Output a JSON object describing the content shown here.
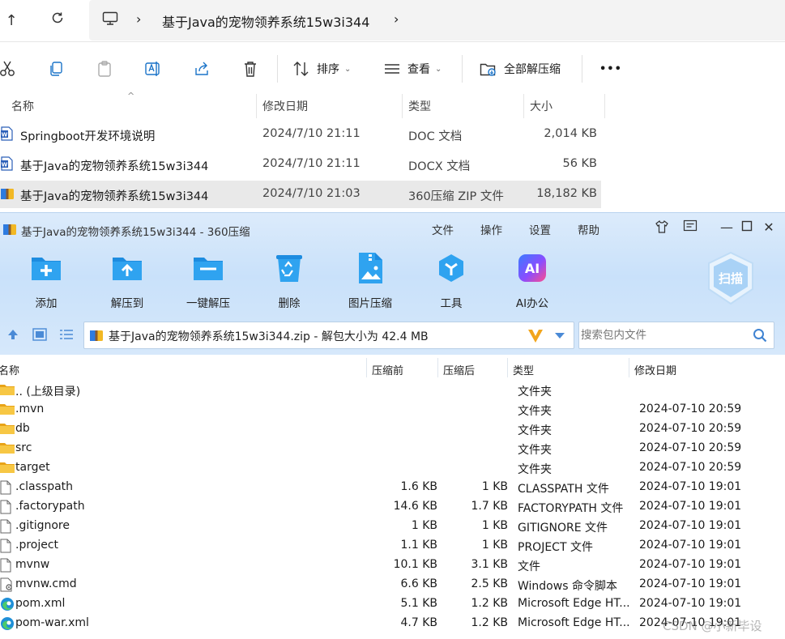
{
  "explorer": {
    "breadcrumb": [
      "基于Java的宠物领养系统15w3i344"
    ],
    "toolbar": {
      "sort_label": "排序",
      "view_label": "查看",
      "extract_all_label": "全部解压缩",
      "more_label": "•••"
    },
    "columns": [
      "名称",
      "修改日期",
      "类型",
      "大小"
    ],
    "files": [
      {
        "name": "Springboot开发环境说明",
        "date": "2024/7/10 21:11",
        "type": "DOC 文档",
        "size": "2,014 KB",
        "icon": "word-doc-icon"
      },
      {
        "name": "基于Java的宠物领养系统15w3i344",
        "date": "2024/7/10 21:11",
        "type": "DOCX 文档",
        "size": "56 KB",
        "icon": "word-doc-icon"
      },
      {
        "name": "基于Java的宠物领养系统15w3i344",
        "date": "2024/7/10 21:03",
        "type": "360压缩 ZIP 文件",
        "size": "18,182 KB",
        "icon": "zip-archive-icon"
      }
    ]
  },
  "zip": {
    "title": "基于Java的宠物领养系统15w3i344 - 360压缩",
    "menu": [
      "文件",
      "操作",
      "设置",
      "帮助"
    ],
    "buttons": [
      "添加",
      "解压到",
      "一键解压",
      "删除",
      "图片压缩",
      "工具",
      "AI办公"
    ],
    "scan_label": "扫描",
    "path_text": "基于Java的宠物领养系统15w3i344.zip - 解包大小为 42.4 MB",
    "search_placeholder": "搜索包内文件",
    "columns": [
      "名称",
      "压缩前",
      "压缩后",
      "类型",
      "修改日期"
    ],
    "rows": [
      {
        "name": ".. (上级目录)",
        "before": "",
        "after": "",
        "type": "文件夹",
        "date": "",
        "icon": "folder-icon"
      },
      {
        "name": ".mvn",
        "before": "",
        "after": "",
        "type": "文件夹",
        "date": "2024-07-10 20:59",
        "icon": "folder-icon"
      },
      {
        "name": "db",
        "before": "",
        "after": "",
        "type": "文件夹",
        "date": "2024-07-10 20:59",
        "icon": "folder-icon"
      },
      {
        "name": "src",
        "before": "",
        "after": "",
        "type": "文件夹",
        "date": "2024-07-10 20:59",
        "icon": "folder-icon"
      },
      {
        "name": "target",
        "before": "",
        "after": "",
        "type": "文件夹",
        "date": "2024-07-10 20:59",
        "icon": "folder-icon"
      },
      {
        "name": ".classpath",
        "before": "1.6 KB",
        "after": "1 KB",
        "type": "CLASSPATH 文件",
        "date": "2024-07-10 19:01",
        "icon": "file-icon"
      },
      {
        "name": ".factorypath",
        "before": "14.6 KB",
        "after": "1.7 KB",
        "type": "FACTORYPATH 文件",
        "date": "2024-07-10 19:01",
        "icon": "file-icon"
      },
      {
        "name": ".gitignore",
        "before": "1 KB",
        "after": "1 KB",
        "type": "GITIGNORE 文件",
        "date": "2024-07-10 19:01",
        "icon": "file-icon"
      },
      {
        "name": ".project",
        "before": "1.1 KB",
        "after": "1 KB",
        "type": "PROJECT 文件",
        "date": "2024-07-10 19:01",
        "icon": "file-icon"
      },
      {
        "name": "mvnw",
        "before": "10.1 KB",
        "after": "3.1 KB",
        "type": "文件",
        "date": "2024-07-10 19:01",
        "icon": "file-icon"
      },
      {
        "name": "mvnw.cmd",
        "before": "6.6 KB",
        "after": "2.5 KB",
        "type": "Windows 命令脚本",
        "date": "2024-07-10 19:01",
        "icon": "cmd-script-icon"
      },
      {
        "name": "pom.xml",
        "before": "5.1 KB",
        "after": "1.2 KB",
        "type": "Microsoft Edge HT...",
        "date": "2024-07-10 19:01",
        "icon": "edge-icon"
      },
      {
        "name": "pom-war.xml",
        "before": "4.7 KB",
        "after": "1.2 KB",
        "type": "Microsoft Edge HT...",
        "date": "2024-07-10 19:01",
        "icon": "edge-icon"
      }
    ]
  },
  "watermark": "CSDN @小新毕设"
}
